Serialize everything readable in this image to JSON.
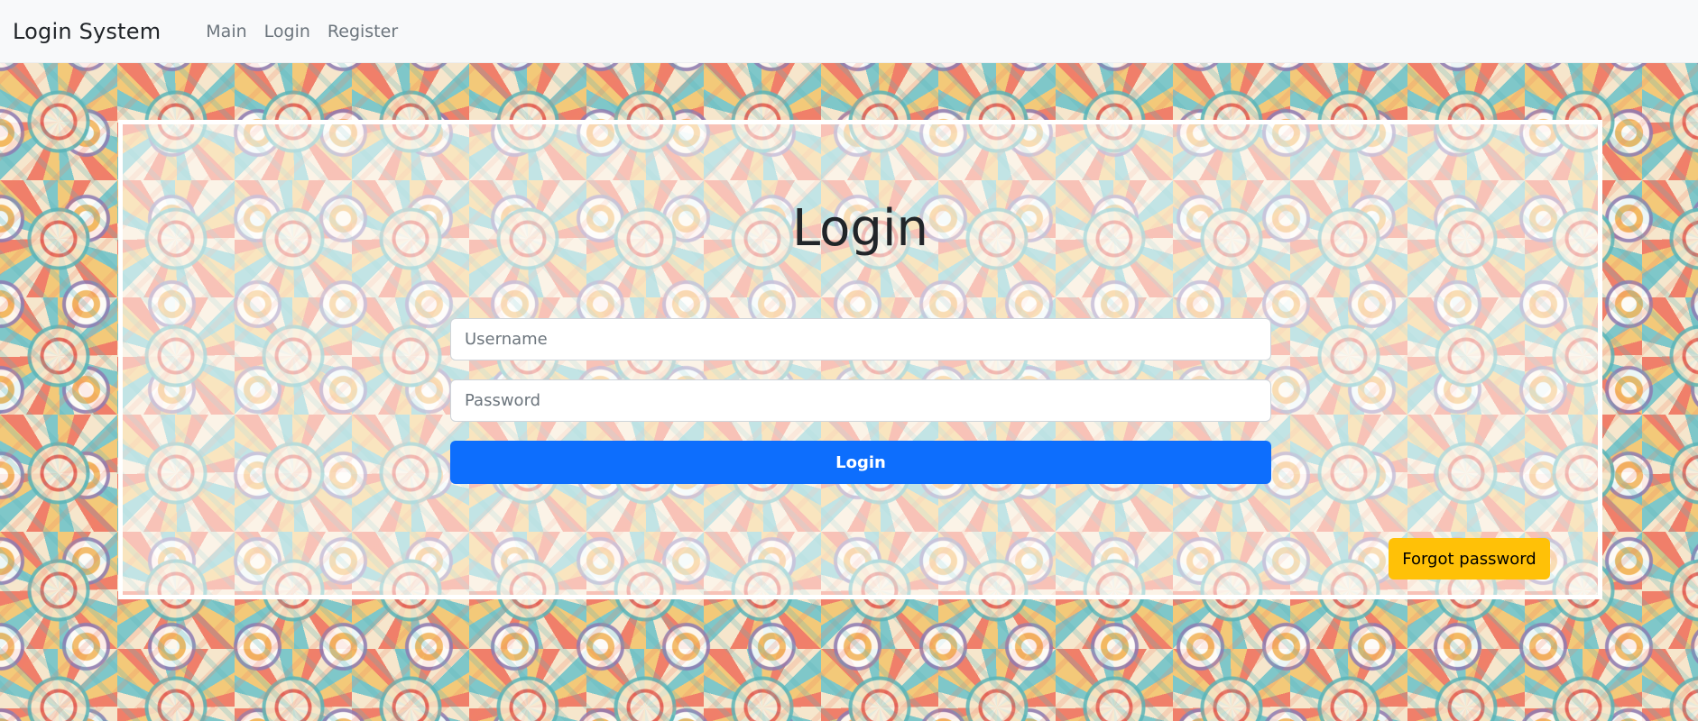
{
  "navbar": {
    "brand": "Login System",
    "links": [
      "Main",
      "Login",
      "Register"
    ]
  },
  "login": {
    "title": "Login",
    "username_placeholder": "Username",
    "password_placeholder": "Password",
    "submit_label": "Login",
    "forgot_label": "Forgot password"
  },
  "colors": {
    "primary": "#0d6efd",
    "warning": "#ffc107",
    "navbar_bg": "#f8f9fa"
  }
}
